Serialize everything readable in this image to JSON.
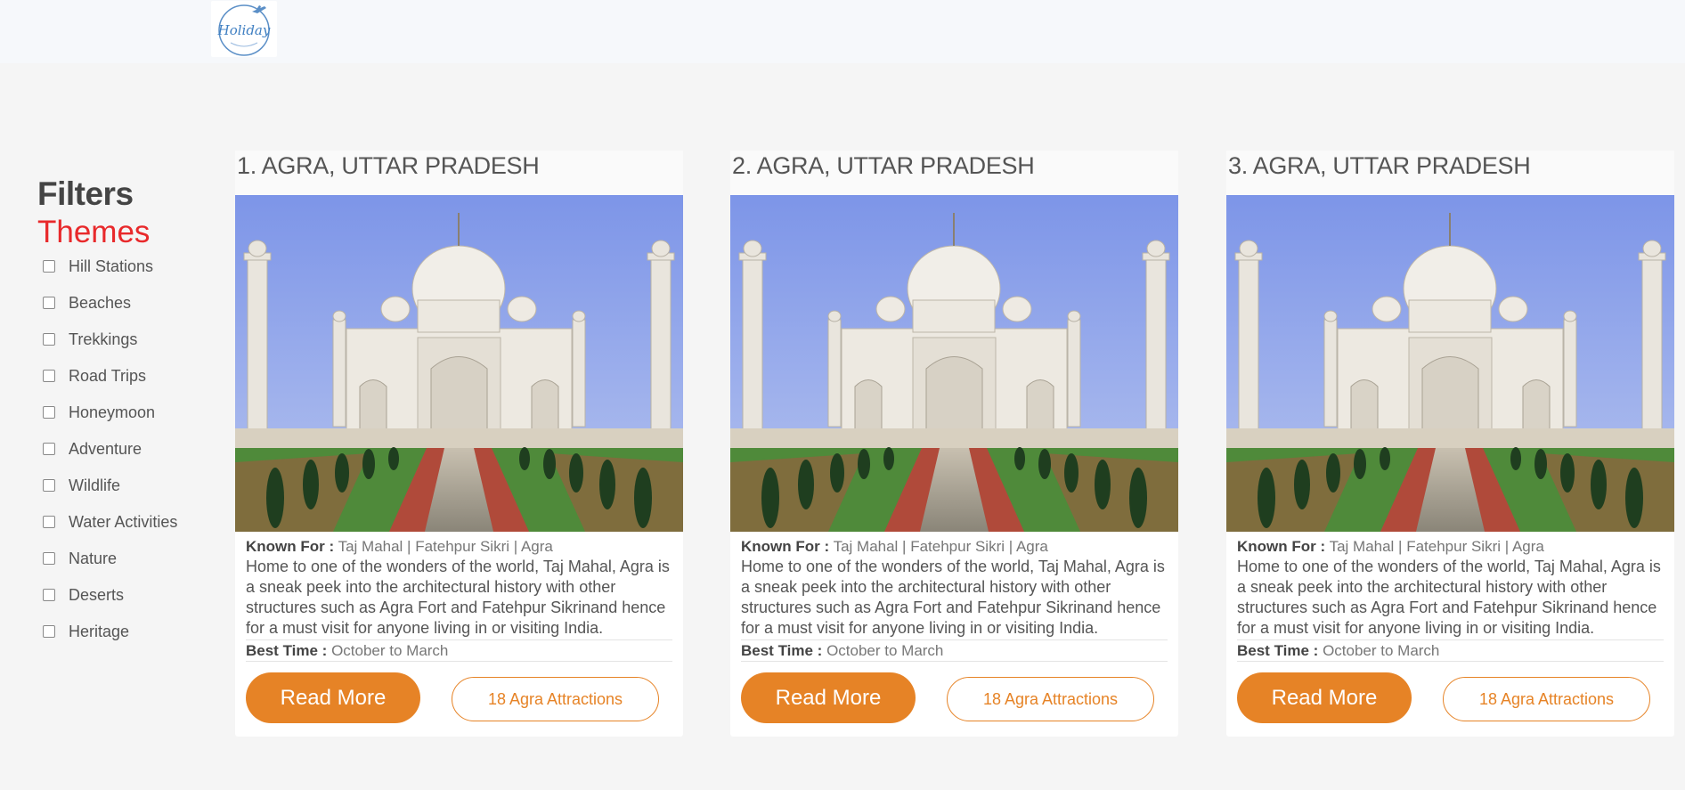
{
  "header": {
    "logo_text": "Holiday"
  },
  "filters": {
    "title": "Filters",
    "themes_title": "Themes",
    "themes": [
      "Hill Stations",
      "Beaches",
      "Trekkings",
      "Road Trips",
      "Honeymoon",
      "Adventure",
      "Wildlife",
      "Water Activities",
      "Nature",
      "Deserts",
      "Heritage"
    ]
  },
  "cards": [
    {
      "title": "1. AGRA, UTTAR PRADESH",
      "known_label": "Known For :",
      "known_value": "Taj Mahal | Fatehpur Sikri | Agra",
      "description": "Home to one of the wonders of the world, Taj Mahal, Agra is a sneak peek into the architectural history with other structures such as Agra Fort and Fatehpur Sikrinand hence for a must visit for anyone living in or visiting India.",
      "best_label": "Best Time :",
      "best_value": "October to March",
      "read_more": "Read More",
      "attractions": "18 Agra Attractions"
    },
    {
      "title": "2. AGRA, UTTAR PRADESH",
      "known_label": "Known For :",
      "known_value": "Taj Mahal | Fatehpur Sikri | Agra",
      "description": "Home to one of the wonders of the world, Taj Mahal, Agra is a sneak peek into the architectural history with other structures such as Agra Fort and Fatehpur Sikrinand hence for a must visit for anyone living in or visiting India.",
      "best_label": "Best Time :",
      "best_value": "October to March",
      "read_more": "Read More",
      "attractions": "18 Agra Attractions"
    },
    {
      "title": "3. AGRA, UTTAR PRADESH",
      "known_label": "Known For :",
      "known_value": "Taj Mahal | Fatehpur Sikri | Agra",
      "description": "Home to one of the wonders of the world, Taj Mahal, Agra is a sneak peek into the architectural history with other structures such as Agra Fort and Fatehpur Sikrinand hence for a must visit for anyone living in or visiting India.",
      "best_label": "Best Time :",
      "best_value": "October to March",
      "read_more": "Read More",
      "attractions": "18 Agra Attractions"
    }
  ],
  "colors": {
    "accent": "#e68326",
    "themes_title": "#e8292b",
    "page_bg": "#f5f5f5"
  }
}
